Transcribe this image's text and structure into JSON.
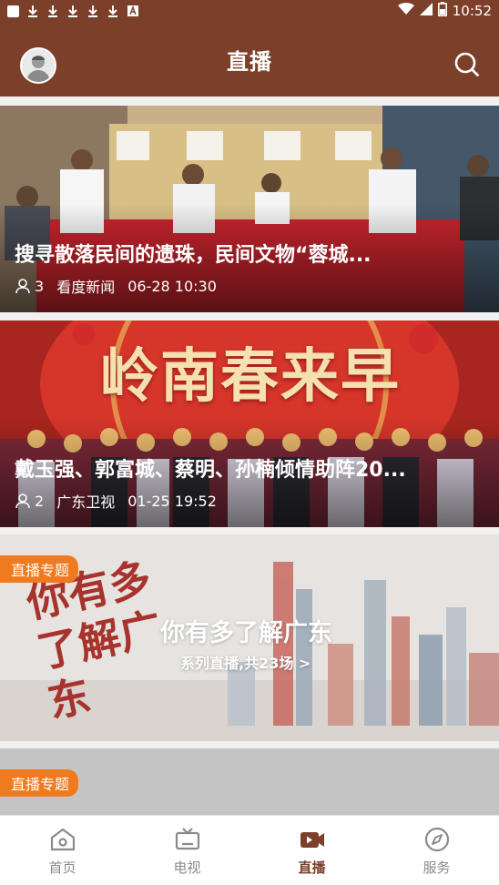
{
  "status_bar": {
    "time": "10:52"
  },
  "app_bar": {
    "title": "直播"
  },
  "cards": [
    {
      "title": "搜寻散落民间的遗珠，民间文物“蓉城...",
      "views": "3",
      "source": "看度新闻",
      "time": "06-28 10:30"
    },
    {
      "title": "戴玉强、郭富城、蔡明、孙楠倾情助阵20...",
      "views": "2",
      "source": "广东卫视",
      "time": "01-25 19:52",
      "banner_text": "岭南春来早"
    }
  ],
  "promo": {
    "badge": "直播专题",
    "title": "你有多了解广东",
    "subtitle": "系列直播,共23场 >",
    "logo_text": "你有多了解广东"
  },
  "promo2": {
    "badge": "直播专题"
  },
  "tabs": [
    {
      "label": "首页",
      "icon": "home-icon"
    },
    {
      "label": "电视",
      "icon": "tv-icon"
    },
    {
      "label": "直播",
      "icon": "live-video-icon"
    },
    {
      "label": "服务",
      "icon": "compass-icon"
    }
  ],
  "colors": {
    "brand": "#7b3f2a",
    "badge": "#f07a1f",
    "active_tab": "#7b3f2a"
  }
}
